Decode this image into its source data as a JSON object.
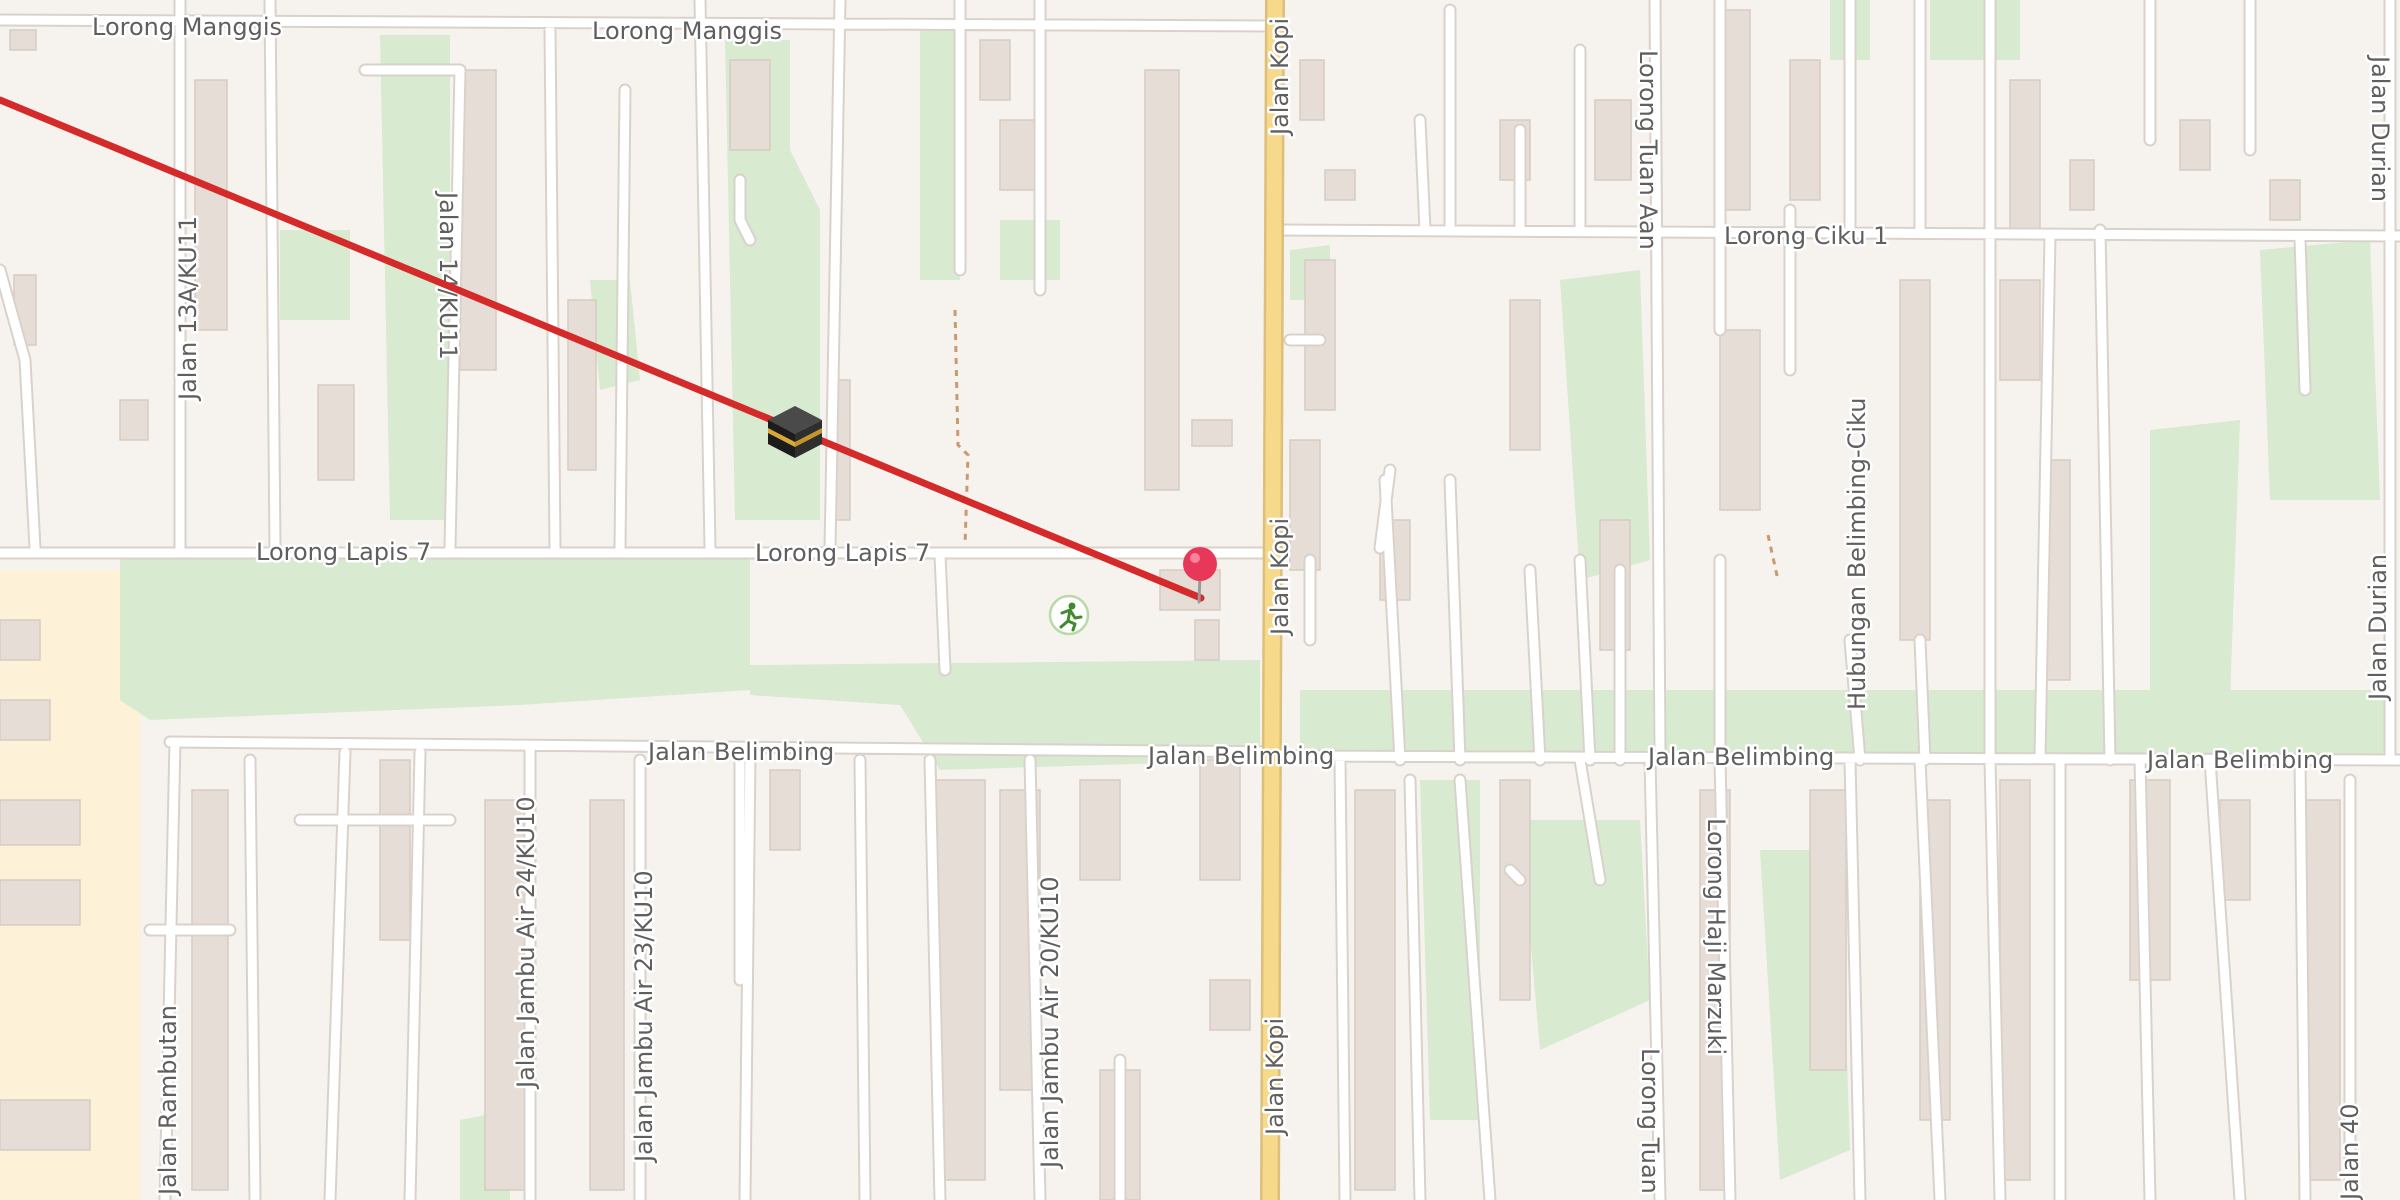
{
  "map": {
    "streets": [
      {
        "id": "lorong-manggis-1",
        "name": "Lorong Manggis"
      },
      {
        "id": "lorong-manggis-2",
        "name": "Lorong Manggis"
      },
      {
        "id": "jalan-13a",
        "name": "Jalan 13A/KU11"
      },
      {
        "id": "jalan-14",
        "name": "Jalan 14/KU11"
      },
      {
        "id": "jalan-kopi-1",
        "name": "Jalan Kopi"
      },
      {
        "id": "jalan-kopi-2",
        "name": "Jalan Kopi"
      },
      {
        "id": "jalan-kopi-3",
        "name": "Jalan Kopi"
      },
      {
        "id": "lorong-tuan-aan",
        "name": "Lorong Tuan Aan"
      },
      {
        "id": "lorong-tuan-bottom",
        "name": "Lorong Tuan"
      },
      {
        "id": "lorong-ciku-1",
        "name": "Lorong Ciku 1"
      },
      {
        "id": "jalan-durian-1",
        "name": "Jalan Durian"
      },
      {
        "id": "jalan-durian-2",
        "name": "Jalan Durian"
      },
      {
        "id": "lorong-lapis-7-1",
        "name": "Lorong Lapis 7"
      },
      {
        "id": "lorong-lapis-7-2",
        "name": "Lorong Lapis 7"
      },
      {
        "id": "hubungan-belimbing-ciku",
        "name": "Hubungan Belimbing-Ciku"
      },
      {
        "id": "jalan-belimbing-1",
        "name": "Jalan Belimbing"
      },
      {
        "id": "jalan-belimbing-2",
        "name": "Jalan Belimbing"
      },
      {
        "id": "jalan-belimbing-3",
        "name": "Jalan Belimbing"
      },
      {
        "id": "jalan-belimbing-4",
        "name": "Jalan Belimbing"
      },
      {
        "id": "jalan-jambu-air-24",
        "name": "Jalan Jambu Air 24/KU10"
      },
      {
        "id": "jalan-jambu-air-23",
        "name": "Jalan Jambu Air 23/KU10"
      },
      {
        "id": "jalan-jambu-air-20",
        "name": "Jalan Jambu Air 20/KU10"
      },
      {
        "id": "lorong-haji-marzuki",
        "name": "Lorong Haji Marzuki"
      },
      {
        "id": "jalan-rambutan",
        "name": "Jalan Rambutan"
      },
      {
        "id": "jalan-40",
        "name": "Jalan 40"
      }
    ],
    "markers": {
      "kaaba": {
        "icon": "kaaba-icon"
      },
      "location_pin": {
        "icon": "location-pin-icon",
        "color": "#e8385a"
      },
      "sports": {
        "icon": "running-person-icon",
        "color": "#3f8a2e"
      }
    },
    "qibla_line": {
      "color": "#d42a2a"
    },
    "colors": {
      "background": "#f6f3ef",
      "park": "#d8ead0",
      "road": "#ffffff",
      "major_road": "#f7d98b",
      "building": "#e6ded6",
      "residential": "#fdf2d8",
      "path": "#c89a6e"
    }
  }
}
